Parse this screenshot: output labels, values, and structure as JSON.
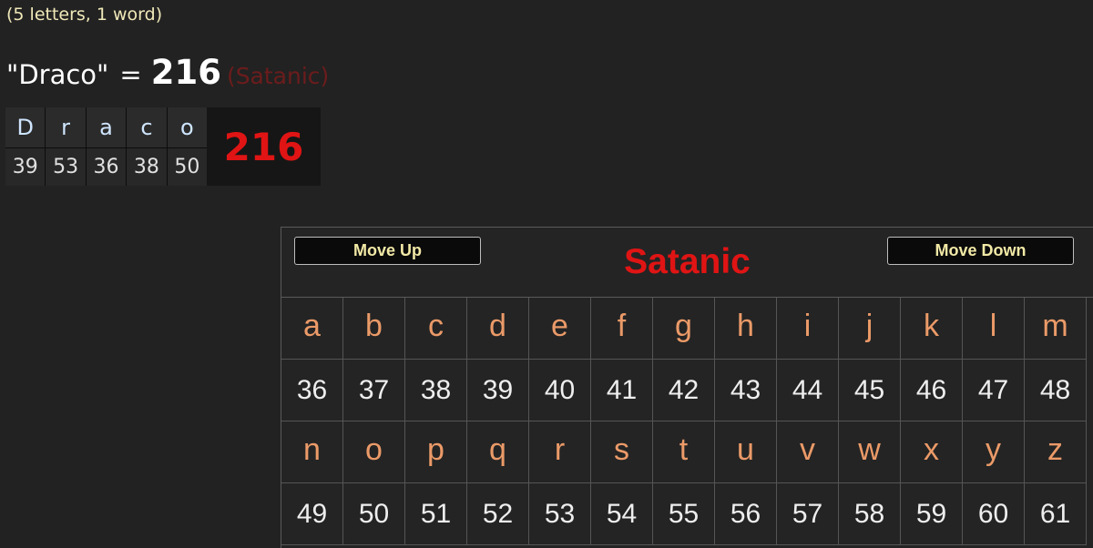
{
  "subtitle": "(5 letters, 1 word)",
  "headline": {
    "phrase": "\"Draco\"",
    "equals": "=",
    "total": "216",
    "cipher": "(Satanic)"
  },
  "breakdown": {
    "letters": [
      {
        "letter": "D",
        "value": "39"
      },
      {
        "letter": "r",
        "value": "53"
      },
      {
        "letter": "a",
        "value": "36"
      },
      {
        "letter": "c",
        "value": "38"
      },
      {
        "letter": "o",
        "value": "50"
      }
    ],
    "total": "216"
  },
  "chart": {
    "move_up_label": "Move Up",
    "move_down_label": "Move Down",
    "title": "Satanic",
    "rows": [
      {
        "letters": [
          "a",
          "b",
          "c",
          "d",
          "e",
          "f",
          "g",
          "h",
          "i",
          "j",
          "k",
          "l",
          "m"
        ],
        "values": [
          "36",
          "37",
          "38",
          "39",
          "40",
          "41",
          "42",
          "43",
          "44",
          "45",
          "46",
          "47",
          "48"
        ]
      },
      {
        "letters": [
          "n",
          "o",
          "p",
          "q",
          "r",
          "s",
          "t",
          "u",
          "v",
          "w",
          "x",
          "y",
          "z"
        ],
        "values": [
          "49",
          "50",
          "51",
          "52",
          "53",
          "54",
          "55",
          "56",
          "57",
          "58",
          "59",
          "60",
          "61"
        ]
      }
    ]
  },
  "colors": {
    "background": "#222222",
    "accent_red": "#e01414",
    "letter_orange": "#eb9a68",
    "subtitle_yellow": "#efe8b8",
    "cipher_dim_red": "#6c1c1c"
  }
}
